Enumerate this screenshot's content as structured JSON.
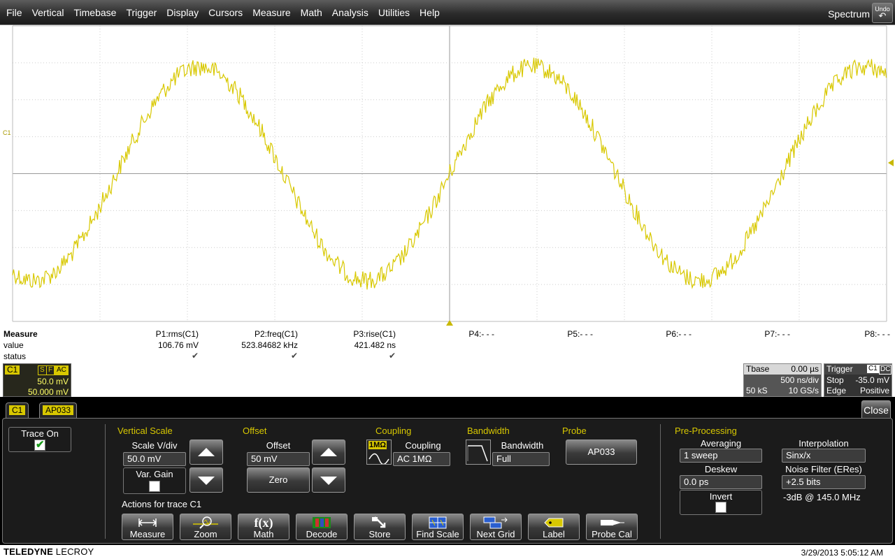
{
  "menubar": {
    "items": [
      "File",
      "Vertical",
      "Timebase",
      "Trigger",
      "Display",
      "Cursors",
      "Measure",
      "Math",
      "Analysis",
      "Utilities",
      "Help"
    ],
    "spectrum_label": "Spectrum",
    "undo_label": "Undo"
  },
  "grid": {
    "channel_marker": "C1",
    "trace_color": "#d8c800",
    "waveform": {
      "period_divisions": 3.81,
      "amplitude_divisions": 2.89,
      "noise_divisions": 0.25
    }
  },
  "measure": {
    "title": "Measure",
    "row_value": "value",
    "row_status": "status",
    "params": [
      {
        "name": "P1:rms(C1)",
        "value": "106.76 mV",
        "status": "✔"
      },
      {
        "name": "P2:freq(C1)",
        "value": "523.84682 kHz",
        "status": "✔"
      },
      {
        "name": "P3:rise(C1)",
        "value": "421.482 ns",
        "status": "✔"
      },
      {
        "name": "P4:- - -",
        "value": "",
        "status": ""
      },
      {
        "name": "P5:- - -",
        "value": "",
        "status": ""
      },
      {
        "name": "P6:- - -",
        "value": "",
        "status": ""
      },
      {
        "name": "P7:- - -",
        "value": "",
        "status": ""
      },
      {
        "name": "P8:- - -",
        "value": "",
        "status": ""
      }
    ]
  },
  "descriptors": {
    "c1": {
      "tag": "C1",
      "flags": [
        "S",
        "F",
        "AC"
      ],
      "scale": "50.0 mV",
      "offset": "50.000 mV"
    },
    "timebase": {
      "title": "Tbase",
      "delay": "0.00 µs",
      "scale": "500 ns/div",
      "samples": "50 kS",
      "rate": "10 GS/s"
    },
    "trigger": {
      "title": "Trigger",
      "source": "C1",
      "coupling": "DC",
      "mode": "Stop",
      "level": "-35.0 mV",
      "type": "Edge",
      "slope": "Positive"
    }
  },
  "dialog": {
    "tabs": [
      "C1",
      "AP033"
    ],
    "close_label": "Close",
    "trace_on_label": "Trace On",
    "trace_on": true,
    "vertical_scale": {
      "section": "Vertical Scale",
      "label": "Scale V/div",
      "value": "50.0 mV",
      "var_gain_label": "Var. Gain"
    },
    "offset": {
      "section": "Offset",
      "label": "Offset",
      "value": "50 mV",
      "zero_label": "Zero"
    },
    "coupling": {
      "section": "Coupling",
      "label": "Coupling",
      "value": "AC 1MΩ",
      "icon_text": "1MΩ"
    },
    "bandwidth": {
      "section": "Bandwidth",
      "label": "Bandwidth",
      "value": "Full"
    },
    "probe": {
      "section": "Probe",
      "button": "AP033"
    },
    "actions_label": "Actions for trace C1",
    "actions": [
      "Measure",
      "Zoom",
      "Math",
      "Decode",
      "Store",
      "Find Scale",
      "Next Grid",
      "Label",
      "Probe Cal"
    ],
    "preprocessing": {
      "section": "Pre-Processing",
      "averaging_label": "Averaging",
      "averaging_value": "1 sweep",
      "deskew_label": "Deskew",
      "deskew_value": "0.0 ps",
      "invert_label": "Invert",
      "interpolation_label": "Interpolation",
      "interpolation_value": "Sinx/x",
      "noise_filter_label": "Noise Filter (ERes)",
      "noise_filter_value": "+2.5 bits",
      "noise_filter_bw": "-3dB @ 145.0 MHz"
    }
  },
  "statusbar": {
    "brand_bold": "TELEDYNE",
    "brand_normal": "LECROY",
    "datetime": "3/29/2013 5:05:12 AM"
  }
}
